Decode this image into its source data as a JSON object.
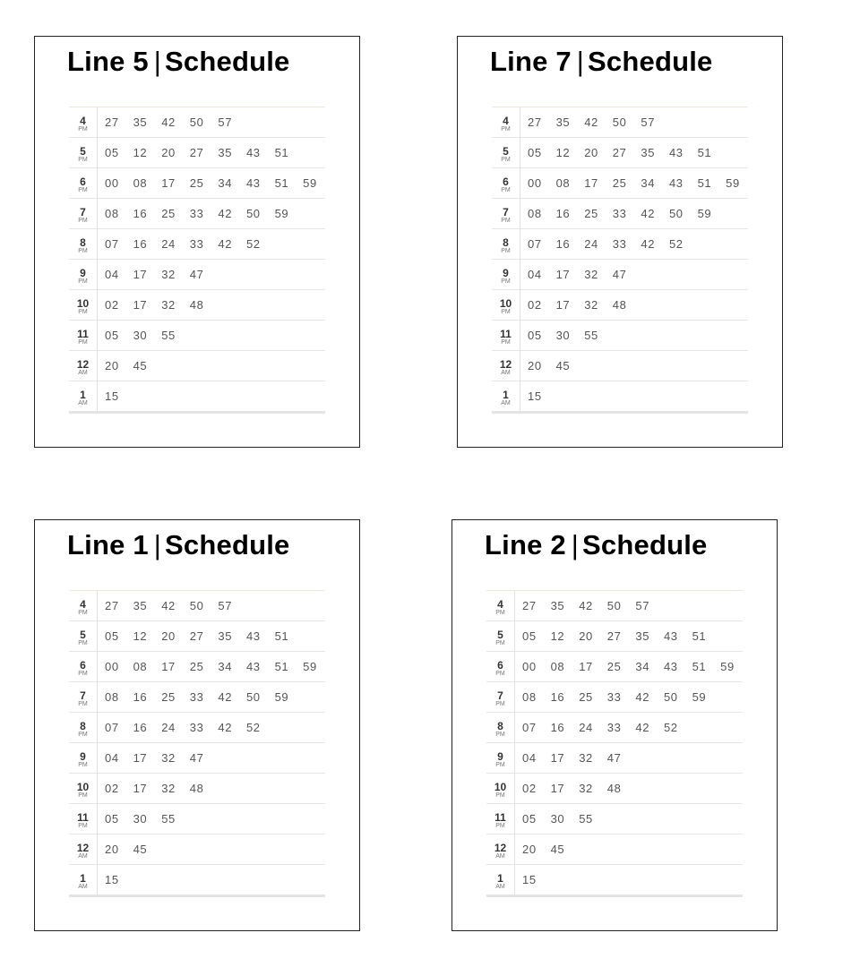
{
  "panels": [
    {
      "line": "Line 5",
      "separator": "|",
      "label": "Schedule"
    },
    {
      "line": "Line 7",
      "separator": "|",
      "label": "Schedule"
    },
    {
      "line": "Line 1",
      "separator": "|",
      "label": "Schedule"
    },
    {
      "line": "Line 2",
      "separator": "|",
      "label": "Schedule"
    }
  ],
  "schedule": [
    {
      "hour": "4",
      "ampm": "PM",
      "minutes": [
        "27",
        "35",
        "42",
        "50",
        "57"
      ]
    },
    {
      "hour": "5",
      "ampm": "PM",
      "minutes": [
        "05",
        "12",
        "20",
        "27",
        "35",
        "43",
        "51"
      ]
    },
    {
      "hour": "6",
      "ampm": "PM",
      "minutes": [
        "00",
        "08",
        "17",
        "25",
        "34",
        "43",
        "51",
        "59"
      ]
    },
    {
      "hour": "7",
      "ampm": "PM",
      "minutes": [
        "08",
        "16",
        "25",
        "33",
        "42",
        "50",
        "59"
      ]
    },
    {
      "hour": "8",
      "ampm": "PM",
      "minutes": [
        "07",
        "16",
        "24",
        "33",
        "42",
        "52"
      ]
    },
    {
      "hour": "9",
      "ampm": "PM",
      "minutes": [
        "04",
        "17",
        "32",
        "47"
      ]
    },
    {
      "hour": "10",
      "ampm": "PM",
      "minutes": [
        "02",
        "17",
        "32",
        "48"
      ]
    },
    {
      "hour": "11",
      "ampm": "PM",
      "minutes": [
        "05",
        "30",
        "55"
      ]
    },
    {
      "hour": "12",
      "ampm": "AM",
      "minutes": [
        "20",
        "45"
      ]
    },
    {
      "hour": "1",
      "ampm": "AM",
      "minutes": [
        "15"
      ]
    }
  ]
}
